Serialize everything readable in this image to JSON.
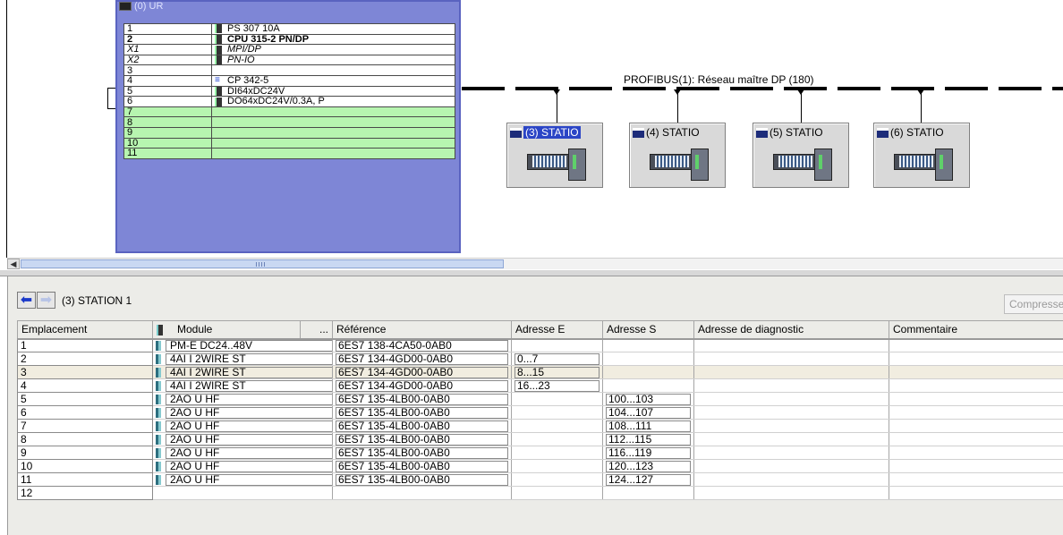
{
  "rack": {
    "title": "(0) UR",
    "rows": [
      {
        "slot": "1",
        "module": "PS 307 10A",
        "style": "filled",
        "icon": "module-icon"
      },
      {
        "slot": "2",
        "module": "CPU 315-2 PN/DP",
        "style": "filled bold",
        "icon": "cpu-icon"
      },
      {
        "slot": "X1",
        "module": "MPI/DP",
        "style": "filled italic",
        "icon": "module-icon"
      },
      {
        "slot": "X2",
        "module": "PN-IO",
        "style": "filled italic",
        "icon": "module-icon"
      },
      {
        "slot": "3",
        "module": "",
        "style": "filled",
        "icon": ""
      },
      {
        "slot": "4",
        "module": "CP 342-5",
        "style": "filled",
        "icon": "network-cp-icon"
      },
      {
        "slot": "5",
        "module": "DI64xDC24V",
        "style": "filled",
        "icon": "module-icon"
      },
      {
        "slot": "6",
        "module": "DO64xDC24V/0.3A, P",
        "style": "filled",
        "icon": "module-icon"
      },
      {
        "slot": "7",
        "module": "",
        "style": "empty",
        "icon": ""
      },
      {
        "slot": "8",
        "module": "",
        "style": "empty",
        "icon": ""
      },
      {
        "slot": "9",
        "module": "",
        "style": "empty",
        "icon": ""
      },
      {
        "slot": "10",
        "module": "",
        "style": "empty",
        "icon": ""
      },
      {
        "slot": "11",
        "module": "",
        "style": "empty",
        "icon": ""
      }
    ]
  },
  "bus": {
    "label": "PROFIBUS(1): Réseau maître DP (180)"
  },
  "stations": [
    {
      "label": "(3) STATIO",
      "selected": true
    },
    {
      "label": "(4) STATIO",
      "selected": false
    },
    {
      "label": "(5) STATIO",
      "selected": false
    },
    {
      "label": "(6) STATIO",
      "selected": false
    }
  ],
  "detail": {
    "title": "(3)  STATION 1",
    "compress_label": "Compresser",
    "columns": [
      "Emplacement",
      "Module",
      "...",
      "Référence",
      "Adresse E",
      "Adresse S",
      "Adresse de diagnostic",
      "Commentaire"
    ],
    "rows": [
      {
        "slot": "1",
        "module": "PM-E DC24..48V",
        "ref": "6ES7 138-4CA50-0AB0",
        "in": "",
        "out": "",
        "highlight": false
      },
      {
        "slot": "2",
        "module": "4AI I 2WIRE ST",
        "ref": "6ES7 134-4GD00-0AB0",
        "in": "0...7",
        "out": "",
        "highlight": false
      },
      {
        "slot": "3",
        "module": "4AI I 2WIRE ST",
        "ref": "6ES7 134-4GD00-0AB0",
        "in": "8...15",
        "out": "",
        "highlight": true
      },
      {
        "slot": "4",
        "module": "4AI I 2WIRE ST",
        "ref": "6ES7 134-4GD00-0AB0",
        "in": "16...23",
        "out": "",
        "highlight": false
      },
      {
        "slot": "5",
        "module": "2AO U HF",
        "ref": "6ES7 135-4LB00-0AB0",
        "in": "",
        "out": "100...103",
        "highlight": false
      },
      {
        "slot": "6",
        "module": "2AO U HF",
        "ref": "6ES7 135-4LB00-0AB0",
        "in": "",
        "out": "104...107",
        "highlight": false
      },
      {
        "slot": "7",
        "module": "2AO U HF",
        "ref": "6ES7 135-4LB00-0AB0",
        "in": "",
        "out": "108...111",
        "highlight": false
      },
      {
        "slot": "8",
        "module": "2AO U HF",
        "ref": "6ES7 135-4LB00-0AB0",
        "in": "",
        "out": "112...115",
        "highlight": false
      },
      {
        "slot": "9",
        "module": "2AO U HF",
        "ref": "6ES7 135-4LB00-0AB0",
        "in": "",
        "out": "116...119",
        "highlight": false
      },
      {
        "slot": "10",
        "module": "2AO U HF",
        "ref": "6ES7 135-4LB00-0AB0",
        "in": "",
        "out": "120...123",
        "highlight": false
      },
      {
        "slot": "11",
        "module": "2AO U HF",
        "ref": "6ES7 135-4LB00-0AB0",
        "in": "",
        "out": "124...127",
        "highlight": false
      },
      {
        "slot": "12",
        "module": "",
        "ref": "",
        "in": "",
        "out": "",
        "highlight": false
      }
    ]
  },
  "colors": {
    "rack_frame": "#7e86d6",
    "empty_slot": "#b7f5b0",
    "selection": "#2b45c6",
    "row_highlight": "#f1ede0"
  }
}
